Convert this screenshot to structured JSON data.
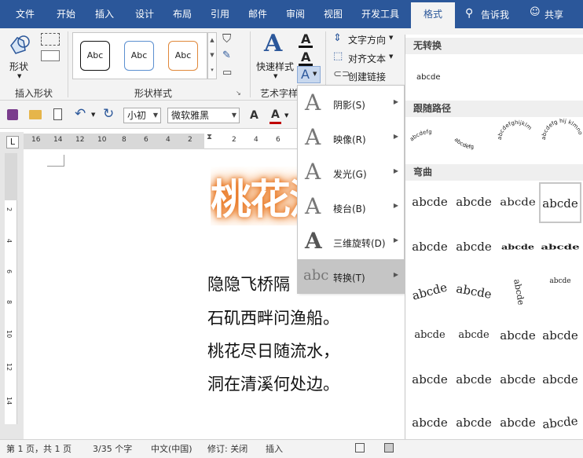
{
  "tabs": [
    "文件",
    "开始",
    "插入",
    "设计",
    "布局",
    "引用",
    "邮件",
    "审阅",
    "视图",
    "开发工具",
    "格式"
  ],
  "tell_me": "告诉我",
  "share": "共享",
  "ribbon": {
    "shape_label": "形状",
    "insert_shapes_label": "插入形状",
    "shape_styles_label": "形状样式",
    "style_sample": "Abc",
    "quick_styles_label": "快速样式",
    "art_text_label": "艺术字样",
    "text_direction": "文字方向",
    "align_text": "对齐文本",
    "create_link": "创建链接"
  },
  "qat": {
    "font_size": "小初",
    "font_name": "微软雅黑"
  },
  "ruler": {
    "h_numbers": [
      "16",
      "14",
      "12",
      "10",
      "8",
      "6",
      "4",
      "2",
      "2",
      "4",
      "6"
    ],
    "v_numbers": [
      "2",
      "4",
      "6",
      "8",
      "10",
      "12",
      "14"
    ]
  },
  "document": {
    "art_text": "桃花流",
    "lines": [
      "隐隐飞桥隔",
      "石矶西畔问渔船。",
      "桃花尽日随流水，",
      "洞在清溪何处边。"
    ]
  },
  "menu": {
    "items": [
      {
        "label": "阴影(S)",
        "icon": "A"
      },
      {
        "label": "映像(R)",
        "icon": "A"
      },
      {
        "label": "发光(G)",
        "icon": "A"
      },
      {
        "label": "棱台(B)",
        "icon": "A"
      },
      {
        "label": "三维旋转(D)",
        "icon": "A"
      },
      {
        "label": "转换(T)",
        "icon": "abc"
      }
    ]
  },
  "gallery": {
    "no_transform": "无转换",
    "no_transform_sample": "abcde",
    "follow_path": "跟随路径",
    "path_samples": [
      "abcdefg",
      "abcdefg",
      "abcdefghijklm",
      "abcdefg hij klmno"
    ],
    "warp": "弯曲",
    "warp_sample": "abcde"
  },
  "status": {
    "page": "第 1 页，共 1 页",
    "words": "3/35 个字",
    "lang": "中文(中国)",
    "revision": "修订: 关闭",
    "insert": "插入"
  },
  "colors": {
    "accent": "#2b579a",
    "glow": "#e8731d",
    "font_color_bar": "#c00000"
  }
}
